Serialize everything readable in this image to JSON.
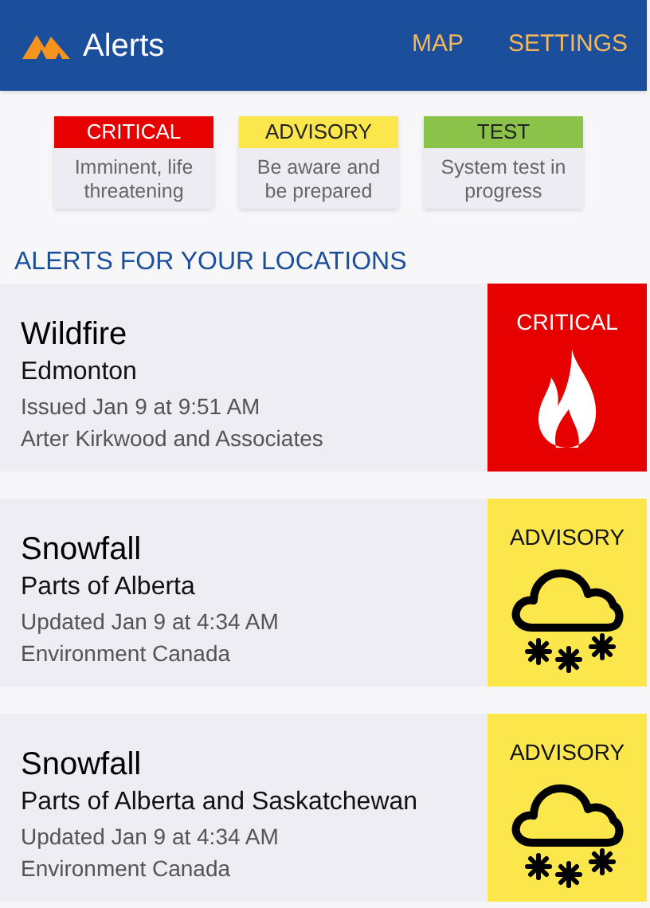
{
  "app_bar": {
    "title": "Alerts",
    "actions": [
      "MAP",
      "SETTINGS"
    ]
  },
  "legend": [
    {
      "label": "CRITICAL",
      "description": "Imminent, life threatening",
      "color": "#e60000"
    },
    {
      "label": "ADVISORY",
      "description": "Be aware and be prepared",
      "color": "#fbe74c"
    },
    {
      "label": "TEST",
      "description": "System test in progress",
      "color": "#8bc34a"
    }
  ],
  "section_title": "ALERTS FOR YOUR LOCATIONS",
  "alerts": [
    {
      "title": "Wildfire",
      "location": "Edmonton",
      "time": "Issued Jan 9 at 9:51 AM",
      "source": "Arter Kirkwood and Associates",
      "badge": "CRITICAL",
      "color": "#e60000",
      "kind": "fire"
    },
    {
      "title": "Snowfall",
      "location": "Parts of Alberta",
      "time": "Updated Jan 9 at 4:34 AM",
      "source": "Environment Canada",
      "badge": "ADVISORY",
      "color": "#fbe74c",
      "kind": "snow"
    },
    {
      "title": "Snowfall",
      "location": "Parts of Alberta and Saskatchewan",
      "time": "Updated Jan 9 at 4:34 AM",
      "source": "Environment Canada",
      "badge": "ADVISORY",
      "color": "#fbe74c",
      "kind": "snow"
    }
  ]
}
